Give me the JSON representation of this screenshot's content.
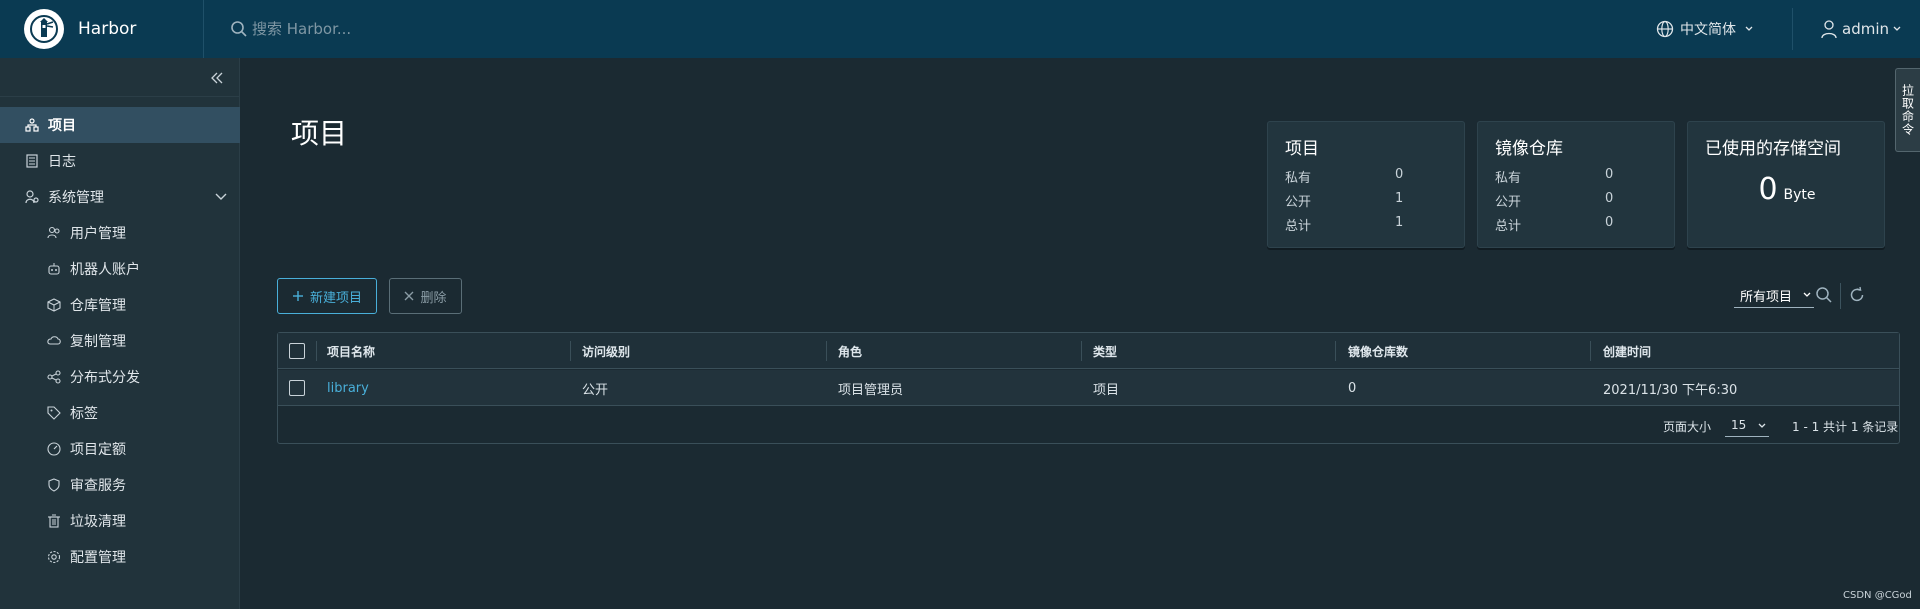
{
  "header": {
    "brand": "Harbor",
    "search_placeholder": "搜索 Harbor...",
    "language": "中文简体",
    "user": "admin"
  },
  "sidebar": {
    "items": [
      {
        "label": "项目",
        "icon": "projects-icon",
        "active": true
      },
      {
        "label": "日志",
        "icon": "logs-icon"
      },
      {
        "label": "系统管理",
        "icon": "admin-icon"
      },
      {
        "label": "用户管理",
        "icon": "users-icon"
      },
      {
        "label": "机器人账户",
        "icon": "robot-icon"
      },
      {
        "label": "仓库管理",
        "icon": "registry-icon"
      },
      {
        "label": "复制管理",
        "icon": "replication-icon"
      },
      {
        "label": "分布式分发",
        "icon": "distribution-icon"
      },
      {
        "label": "标签",
        "icon": "tag-icon"
      },
      {
        "label": "项目定额",
        "icon": "quota-icon"
      },
      {
        "label": "审查服务",
        "icon": "shield-icon"
      },
      {
        "label": "垃圾清理",
        "icon": "trash-icon"
      },
      {
        "label": "配置管理",
        "icon": "gear-icon"
      }
    ]
  },
  "page": {
    "title": "项目"
  },
  "cards": {
    "projects": {
      "title": "项目",
      "rows": [
        {
          "label": "私有",
          "value": "0"
        },
        {
          "label": "公开",
          "value": "1"
        },
        {
          "label": "总计",
          "value": "1"
        }
      ]
    },
    "repos": {
      "title": "镜像仓库",
      "rows": [
        {
          "label": "私有",
          "value": "0"
        },
        {
          "label": "公开",
          "value": "0"
        },
        {
          "label": "总计",
          "value": "0"
        }
      ]
    },
    "storage": {
      "title": "已使用的存储空间",
      "value": "0",
      "unit": "Byte"
    }
  },
  "toolbar": {
    "new_label": "新建项目",
    "delete_label": "删除",
    "filter_label": "所有项目"
  },
  "table": {
    "columns": [
      "项目名称",
      "访问级别",
      "角色",
      "类型",
      "镜像仓库数",
      "创建时间"
    ],
    "rows": [
      {
        "name": "library",
        "access": "公开",
        "role": "项目管理员",
        "type": "项目",
        "repo_count": "0",
        "created": "2021/11/30 下午6:30"
      }
    ],
    "footer": {
      "page_size_label": "页面大小",
      "page_size": "15",
      "count_text": "1 - 1 共计 1 条记录"
    }
  },
  "side_panel_label": "拉取命令",
  "watermark": "CSDN @CGod",
  "colors": {
    "accent": "#49afd9",
    "header": "#0a3a52",
    "background": "#1b2a32"
  }
}
